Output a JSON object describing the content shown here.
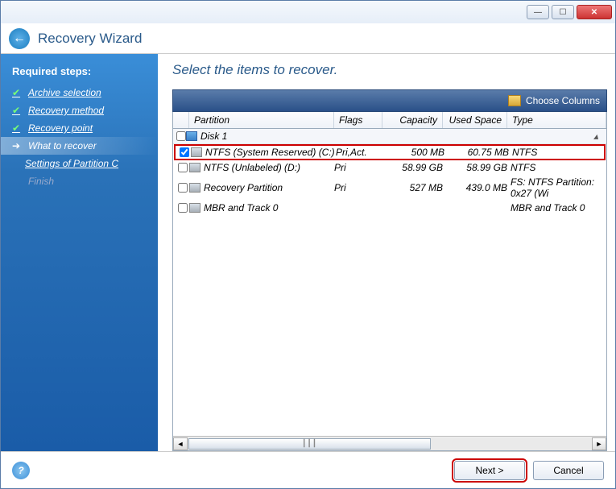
{
  "window": {
    "title": "Recovery Wizard"
  },
  "sidebar": {
    "header": "Required steps:",
    "items": [
      {
        "label": "Archive selection",
        "state": "done"
      },
      {
        "label": "Recovery method",
        "state": "done"
      },
      {
        "label": "Recovery point",
        "state": "done"
      },
      {
        "label": "What to recover",
        "state": "current"
      },
      {
        "label": "Settings of Partition C",
        "state": "sub"
      },
      {
        "label": "Finish",
        "state": "disabled"
      }
    ]
  },
  "main": {
    "title": "Select the items to recover.",
    "choose_columns": "Choose Columns",
    "columns": {
      "partition": "Partition",
      "flags": "Flags",
      "capacity": "Capacity",
      "used": "Used Space",
      "type": "Type"
    },
    "disk_label": "Disk 1",
    "rows": [
      {
        "checked": true,
        "name": "NTFS (System Reserved) (C:)",
        "flags": "Pri,Act.",
        "capacity": "500 MB",
        "used": "60.75 MB",
        "type": "NTFS",
        "highlight": true
      },
      {
        "checked": false,
        "name": "NTFS (Unlabeled) (D:)",
        "flags": "Pri",
        "capacity": "58.99 GB",
        "used": "58.99 GB",
        "type": "NTFS"
      },
      {
        "checked": false,
        "name": "Recovery Partition",
        "flags": "Pri",
        "capacity": "527 MB",
        "used": "439.0 MB",
        "type": "FS: NTFS Partition: 0x27 (Wi"
      },
      {
        "checked": false,
        "name": "MBR and Track 0",
        "flags": "",
        "capacity": "",
        "used": "",
        "type": "MBR and Track 0"
      }
    ]
  },
  "footer": {
    "next": "Next >",
    "cancel": "Cancel"
  }
}
